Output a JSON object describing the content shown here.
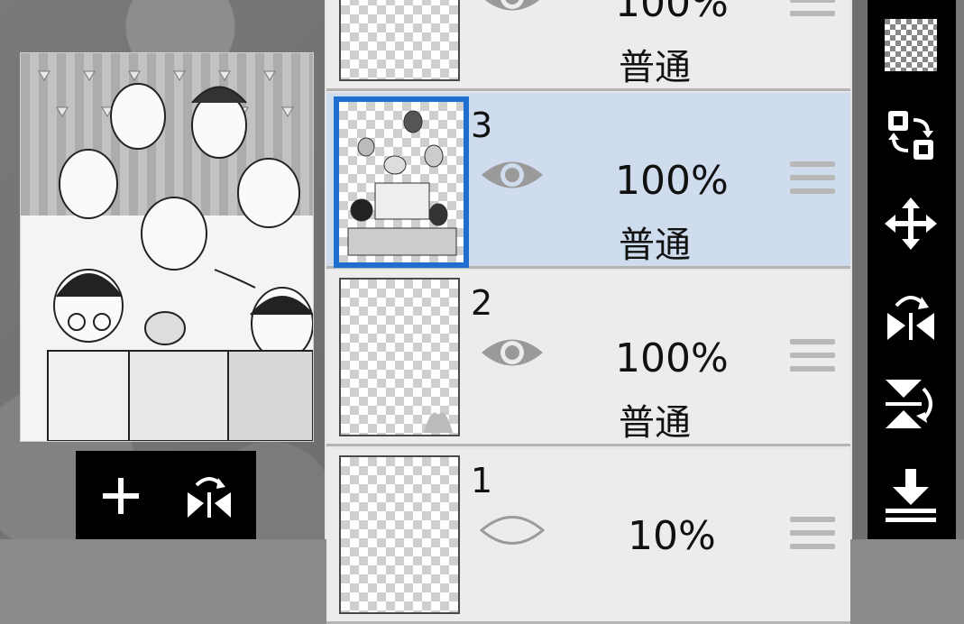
{
  "layers": [
    {
      "number": "",
      "opacity": "100%",
      "mode": "普通",
      "visible": true,
      "selected": false
    },
    {
      "number": "3",
      "opacity": "100%",
      "mode": "普通",
      "visible": true,
      "selected": true
    },
    {
      "number": "2",
      "opacity": "100%",
      "mode": "普通",
      "visible": true,
      "selected": false
    },
    {
      "number": "1",
      "opacity": "10%",
      "mode": "",
      "visible": true,
      "selected": false
    }
  ],
  "preview_toolbar": {
    "buttons": [
      {
        "icon": "plus-icon"
      },
      {
        "icon": "flip-horizontal-icon"
      }
    ]
  },
  "tools": [
    {
      "icon": "transparency-icon"
    },
    {
      "icon": "swap-layer-icon"
    },
    {
      "icon": "move-icon"
    },
    {
      "icon": "flip-horizontal-icon"
    },
    {
      "icon": "flip-vertical-icon"
    },
    {
      "icon": "merge-down-icon"
    }
  ],
  "colors": {
    "selected_bg": "#cfdcee",
    "selected_border": "#1f6fd0",
    "panel_bg": "#ececec",
    "toolbar_bg": "#000000"
  }
}
